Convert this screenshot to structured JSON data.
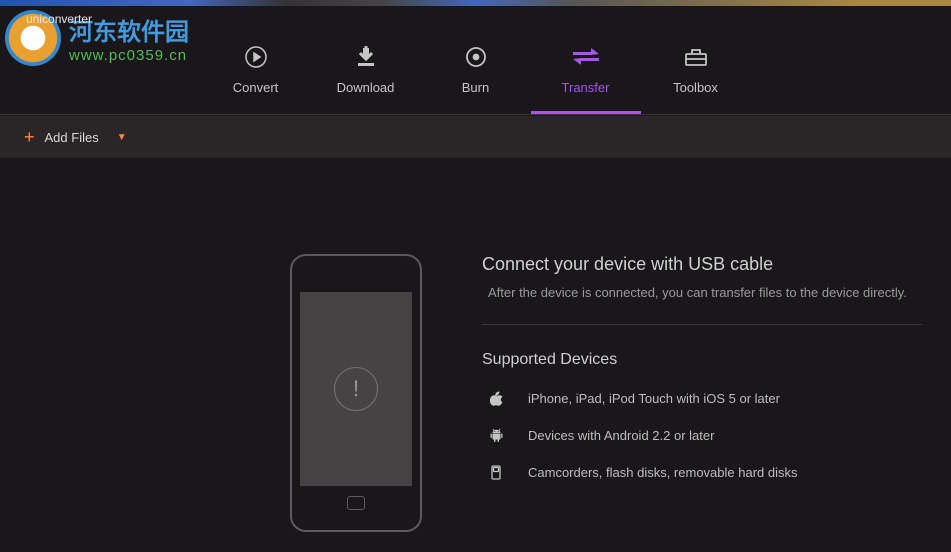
{
  "app": {
    "name": "uniconverter"
  },
  "watermark": {
    "line1": "河东软件园",
    "line2": "www.pc0359.cn"
  },
  "nav": {
    "items": [
      {
        "label": "Convert"
      },
      {
        "label": "Download"
      },
      {
        "label": "Burn"
      },
      {
        "label": "Transfer"
      },
      {
        "label": "Toolbox"
      }
    ]
  },
  "toolbar": {
    "add_files_label": "Add Files"
  },
  "transfer": {
    "title": "Connect your device with USB cable",
    "subtitle": "After the device is connected, you can transfer files to the device directly.",
    "supported_title": "Supported Devices",
    "devices": [
      {
        "text": "iPhone, iPad, iPod Touch with iOS 5 or later"
      },
      {
        "text": "Devices with Android 2.2 or later"
      },
      {
        "text": "Camcorders, flash disks, removable hard disks"
      }
    ]
  }
}
